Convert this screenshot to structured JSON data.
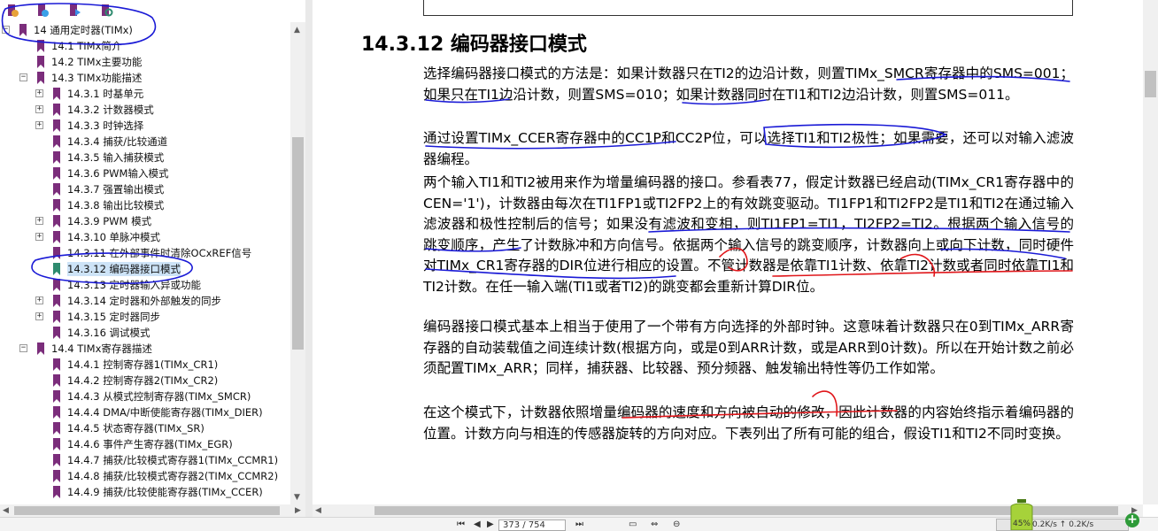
{
  "toolbar": {
    "icons": [
      "expand-all-icon",
      "collapse-all-icon",
      "bookmark-add-icon",
      "bookmark-find-icon"
    ]
  },
  "tree": {
    "items": [
      {
        "label": "14 通用定时器(TIMx)",
        "level": 0,
        "expander": "−"
      },
      {
        "label": "14.1 TIMx简介",
        "level": 1,
        "expander": ""
      },
      {
        "label": "14.2 TIMx主要功能",
        "level": 1,
        "expander": ""
      },
      {
        "label": "14.3 TIMx功能描述",
        "level": 1,
        "expander": "−"
      },
      {
        "label": "14.3.1 时基单元",
        "level": 2,
        "expander": "+"
      },
      {
        "label": "14.3.2 计数器模式",
        "level": 2,
        "expander": "+"
      },
      {
        "label": "14.3.3 时钟选择",
        "level": 2,
        "expander": "+"
      },
      {
        "label": "14.3.4 捕获/比较通道",
        "level": 2,
        "expander": ""
      },
      {
        "label": "14.3.5 输入捕获模式",
        "level": 2,
        "expander": ""
      },
      {
        "label": "14.3.6 PWM输入模式",
        "level": 2,
        "expander": ""
      },
      {
        "label": "14.3.7 强置输出模式",
        "level": 2,
        "expander": ""
      },
      {
        "label": "14.3.8 输出比较模式",
        "level": 2,
        "expander": ""
      },
      {
        "label": "14.3.9 PWM 模式",
        "level": 2,
        "expander": "+"
      },
      {
        "label": "14.3.10 单脉冲模式",
        "level": 2,
        "expander": "+"
      },
      {
        "label": "14.3.11 在外部事件时清除OCxREF信号",
        "level": 2,
        "expander": ""
      },
      {
        "label": "14.3.12 编码器接口模式",
        "level": 2,
        "expander": "",
        "selected": true
      },
      {
        "label": "14.3.13 定时器输入异或功能",
        "level": 2,
        "expander": ""
      },
      {
        "label": "14.3.14 定时器和外部触发的同步",
        "level": 2,
        "expander": "+"
      },
      {
        "label": "14.3.15 定时器同步",
        "level": 2,
        "expander": "+"
      },
      {
        "label": "14.3.16 调试模式",
        "level": 2,
        "expander": ""
      },
      {
        "label": "14.4 TIMx寄存器描述",
        "level": 1,
        "expander": "−"
      },
      {
        "label": "14.4.1 控制寄存器1(TIMx_CR1)",
        "level": 2,
        "expander": ""
      },
      {
        "label": "14.4.2 控制寄存器2(TIMx_CR2)",
        "level": 2,
        "expander": ""
      },
      {
        "label": "14.4.3 从模式控制寄存器(TIMx_SMCR)",
        "level": 2,
        "expander": ""
      },
      {
        "label": "14.4.4 DMA/中断使能寄存器(TIMx_DIER)",
        "level": 2,
        "expander": ""
      },
      {
        "label": "14.4.5 状态寄存器(TIMx_SR)",
        "level": 2,
        "expander": ""
      },
      {
        "label": "14.4.6 事件产生寄存器(TIMx_EGR)",
        "level": 2,
        "expander": ""
      },
      {
        "label": "14.4.7 捕获/比较模式寄存器1(TIMx_CCMR1)",
        "level": 2,
        "expander": ""
      },
      {
        "label": "14.4.8 捕获/比较模式寄存器2(TIMx_CCMR2)",
        "level": 2,
        "expander": ""
      },
      {
        "label": "14.4.9 捕获/比较使能寄存器(TIMx_CCER)",
        "level": 2,
        "expander": ""
      }
    ]
  },
  "document": {
    "section_title": "14.3.12 编码器接口模式",
    "paragraphs": [
      "选择编码器接口模式的方法是：如果计数器只在TI2的边沿计数，则置TIMx_SMCR寄存器中的SMS=001；如果只在TI1边沿计数，则置SMS=010；如果计数器同时在TI1和TI2边沿计数，则置SMS=011。",
      "通过设置TIMx_CCER寄存器中的CC1P和CC2P位，可以选择TI1和TI2极性；如果需要，还可以对输入滤波器编程。",
      "两个输入TI1和TI2被用来作为增量编码器的接口。参看表77，假定计数器已经启动(TIMx_CR1寄存器中的CEN='1')，计数器由每次在TI1FP1或TI2FP2上的有效跳变驱动。TI1FP1和TI2FP2是TI1和TI2在通过输入滤波器和极性控制后的信号；如果没有滤波和变相，则TI1FP1=TI1，TI2FP2=TI2。根据两个输入信号的跳变顺序，产生了计数脉冲和方向信号。依据两个输入信号的跳变顺序，计数器向上或向下计数，同时硬件对TIMx_CR1寄存器的DIR位进行相应的设置。不管计数器是依靠TI1计数、依靠TI2计数或者同时依靠TI1和TI2计数。在任一输入端(TI1或者TI2)的跳变都会重新计算DIR位。",
      "编码器接口模式基本上相当于使用了一个带有方向选择的外部时钟。这意味着计数器只在0到TIMx_ARR寄存器的自动装载值之间连续计数(根据方向，或是0到ARR计数，或是ARR到0计数)。所以在开始计数之前必须配置TIMx_ARR；同样，捕获器、比较器、预分频器、触发输出特性等仍工作如常。",
      "在这个模式下，计数器依照增量编码器的速度和方向被自动的修改，因此计数器的内容始终指示着编码器的位置。计数方向与相连的传感器旋转的方向对应。下表列出了所有可能的组合，假设TI1和TI2不同时变换。"
    ]
  },
  "status": {
    "page_field": "373 / 754",
    "battery_percent": "45%",
    "zoom_label": "0.2K/s  ↑ 0.2K/s"
  },
  "colors": {
    "bookmark": "#7b2d7b",
    "bookmark_current": "#2e8b6f",
    "annotation_blue": "#1a1ad6",
    "annotation_red": "#e0161a",
    "selection": "#cde3f7"
  }
}
